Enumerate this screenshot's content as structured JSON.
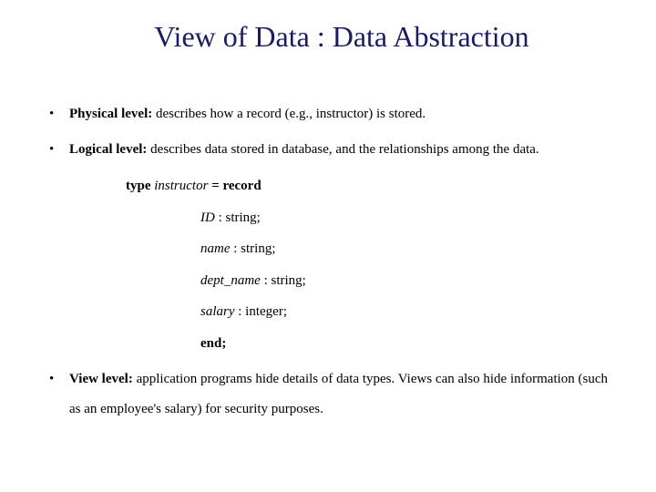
{
  "title": "View of Data : Data Abstraction",
  "bullets": {
    "physical": {
      "label": "Physical level:",
      "text": " describes how a record (e.g., instructor) is stored."
    },
    "logical": {
      "label": "Logical level:",
      "text": " describes data stored in database, and the relationships among the data."
    },
    "view": {
      "label": "View level:",
      "text": " application programs hide details of data types. Views can also hide information (such as an employee's salary) for security purposes."
    }
  },
  "record": {
    "type_kw": "type",
    "name": " instructor ",
    "eq_record": "= record",
    "fields": [
      {
        "id": "ID",
        "rest": " : string;"
      },
      {
        "id": "name",
        "rest": " : string;"
      },
      {
        "id": "dept_name",
        "rest": " : string;"
      },
      {
        "id": "salary",
        "rest": " : integer;"
      }
    ],
    "end": "end;"
  }
}
